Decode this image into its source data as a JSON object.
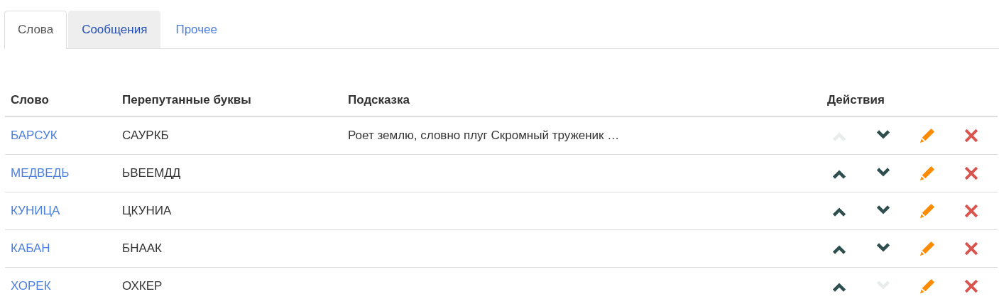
{
  "tabs": [
    {
      "label": "Слова",
      "selected": true,
      "hovered": false
    },
    {
      "label": "Сообщения",
      "selected": false,
      "hovered": true
    },
    {
      "label": "Прочее",
      "selected": false,
      "hovered": false
    }
  ],
  "table": {
    "columns": [
      "Слово",
      "Перепутанные буквы",
      "Подсказка",
      "Действия"
    ],
    "rows": [
      {
        "word": "БАРСУК",
        "scrambled": "САУРКБ",
        "hint": "Роет землю, словно плуг Скромный труженик …",
        "up_disabled": true,
        "down_disabled": false
      },
      {
        "word": "МЕДВЕДЬ",
        "scrambled": "ЬВЕЕМДД",
        "up_disabled": false,
        "down_disabled": false
      },
      {
        "word": "КУНИЦА",
        "scrambled": "ЦКУНИА",
        "up_disabled": false,
        "down_disabled": false
      },
      {
        "word": "КАБАН",
        "scrambled": "БНААК",
        "up_disabled": false,
        "down_disabled": false
      },
      {
        "word": "ХОРЕК",
        "scrambled": "ОХКЕР",
        "up_disabled": false,
        "down_disabled": true
      }
    ]
  }
}
